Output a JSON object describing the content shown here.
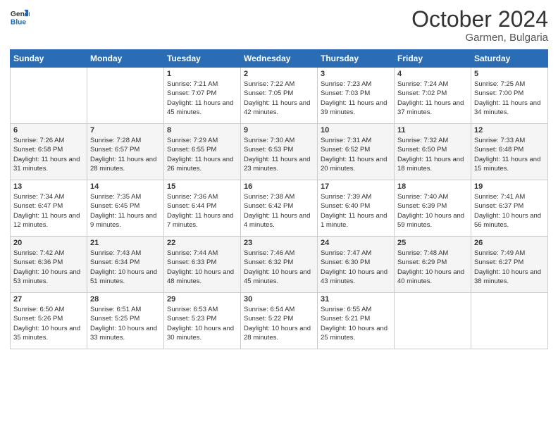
{
  "logo": {
    "line1": "General",
    "line2": "Blue"
  },
  "header": {
    "month": "October 2024",
    "location": "Garmen, Bulgaria"
  },
  "weekdays": [
    "Sunday",
    "Monday",
    "Tuesday",
    "Wednesday",
    "Thursday",
    "Friday",
    "Saturday"
  ],
  "rows": [
    [
      {
        "day": "",
        "sunrise": "",
        "sunset": "",
        "daylight": ""
      },
      {
        "day": "",
        "sunrise": "",
        "sunset": "",
        "daylight": ""
      },
      {
        "day": "1",
        "sunrise": "Sunrise: 7:21 AM",
        "sunset": "Sunset: 7:07 PM",
        "daylight": "Daylight: 11 hours and 45 minutes."
      },
      {
        "day": "2",
        "sunrise": "Sunrise: 7:22 AM",
        "sunset": "Sunset: 7:05 PM",
        "daylight": "Daylight: 11 hours and 42 minutes."
      },
      {
        "day": "3",
        "sunrise": "Sunrise: 7:23 AM",
        "sunset": "Sunset: 7:03 PM",
        "daylight": "Daylight: 11 hours and 39 minutes."
      },
      {
        "day": "4",
        "sunrise": "Sunrise: 7:24 AM",
        "sunset": "Sunset: 7:02 PM",
        "daylight": "Daylight: 11 hours and 37 minutes."
      },
      {
        "day": "5",
        "sunrise": "Sunrise: 7:25 AM",
        "sunset": "Sunset: 7:00 PM",
        "daylight": "Daylight: 11 hours and 34 minutes."
      }
    ],
    [
      {
        "day": "6",
        "sunrise": "Sunrise: 7:26 AM",
        "sunset": "Sunset: 6:58 PM",
        "daylight": "Daylight: 11 hours and 31 minutes."
      },
      {
        "day": "7",
        "sunrise": "Sunrise: 7:28 AM",
        "sunset": "Sunset: 6:57 PM",
        "daylight": "Daylight: 11 hours and 28 minutes."
      },
      {
        "day": "8",
        "sunrise": "Sunrise: 7:29 AM",
        "sunset": "Sunset: 6:55 PM",
        "daylight": "Daylight: 11 hours and 26 minutes."
      },
      {
        "day": "9",
        "sunrise": "Sunrise: 7:30 AM",
        "sunset": "Sunset: 6:53 PM",
        "daylight": "Daylight: 11 hours and 23 minutes."
      },
      {
        "day": "10",
        "sunrise": "Sunrise: 7:31 AM",
        "sunset": "Sunset: 6:52 PM",
        "daylight": "Daylight: 11 hours and 20 minutes."
      },
      {
        "day": "11",
        "sunrise": "Sunrise: 7:32 AM",
        "sunset": "Sunset: 6:50 PM",
        "daylight": "Daylight: 11 hours and 18 minutes."
      },
      {
        "day": "12",
        "sunrise": "Sunrise: 7:33 AM",
        "sunset": "Sunset: 6:48 PM",
        "daylight": "Daylight: 11 hours and 15 minutes."
      }
    ],
    [
      {
        "day": "13",
        "sunrise": "Sunrise: 7:34 AM",
        "sunset": "Sunset: 6:47 PM",
        "daylight": "Daylight: 11 hours and 12 minutes."
      },
      {
        "day": "14",
        "sunrise": "Sunrise: 7:35 AM",
        "sunset": "Sunset: 6:45 PM",
        "daylight": "Daylight: 11 hours and 9 minutes."
      },
      {
        "day": "15",
        "sunrise": "Sunrise: 7:36 AM",
        "sunset": "Sunset: 6:44 PM",
        "daylight": "Daylight: 11 hours and 7 minutes."
      },
      {
        "day": "16",
        "sunrise": "Sunrise: 7:38 AM",
        "sunset": "Sunset: 6:42 PM",
        "daylight": "Daylight: 11 hours and 4 minutes."
      },
      {
        "day": "17",
        "sunrise": "Sunrise: 7:39 AM",
        "sunset": "Sunset: 6:40 PM",
        "daylight": "Daylight: 11 hours and 1 minute."
      },
      {
        "day": "18",
        "sunrise": "Sunrise: 7:40 AM",
        "sunset": "Sunset: 6:39 PM",
        "daylight": "Daylight: 10 hours and 59 minutes."
      },
      {
        "day": "19",
        "sunrise": "Sunrise: 7:41 AM",
        "sunset": "Sunset: 6:37 PM",
        "daylight": "Daylight: 10 hours and 56 minutes."
      }
    ],
    [
      {
        "day": "20",
        "sunrise": "Sunrise: 7:42 AM",
        "sunset": "Sunset: 6:36 PM",
        "daylight": "Daylight: 10 hours and 53 minutes."
      },
      {
        "day": "21",
        "sunrise": "Sunrise: 7:43 AM",
        "sunset": "Sunset: 6:34 PM",
        "daylight": "Daylight: 10 hours and 51 minutes."
      },
      {
        "day": "22",
        "sunrise": "Sunrise: 7:44 AM",
        "sunset": "Sunset: 6:33 PM",
        "daylight": "Daylight: 10 hours and 48 minutes."
      },
      {
        "day": "23",
        "sunrise": "Sunrise: 7:46 AM",
        "sunset": "Sunset: 6:32 PM",
        "daylight": "Daylight: 10 hours and 45 minutes."
      },
      {
        "day": "24",
        "sunrise": "Sunrise: 7:47 AM",
        "sunset": "Sunset: 6:30 PM",
        "daylight": "Daylight: 10 hours and 43 minutes."
      },
      {
        "day": "25",
        "sunrise": "Sunrise: 7:48 AM",
        "sunset": "Sunset: 6:29 PM",
        "daylight": "Daylight: 10 hours and 40 minutes."
      },
      {
        "day": "26",
        "sunrise": "Sunrise: 7:49 AM",
        "sunset": "Sunset: 6:27 PM",
        "daylight": "Daylight: 10 hours and 38 minutes."
      }
    ],
    [
      {
        "day": "27",
        "sunrise": "Sunrise: 6:50 AM",
        "sunset": "Sunset: 5:26 PM",
        "daylight": "Daylight: 10 hours and 35 minutes."
      },
      {
        "day": "28",
        "sunrise": "Sunrise: 6:51 AM",
        "sunset": "Sunset: 5:25 PM",
        "daylight": "Daylight: 10 hours and 33 minutes."
      },
      {
        "day": "29",
        "sunrise": "Sunrise: 6:53 AM",
        "sunset": "Sunset: 5:23 PM",
        "daylight": "Daylight: 10 hours and 30 minutes."
      },
      {
        "day": "30",
        "sunrise": "Sunrise: 6:54 AM",
        "sunset": "Sunset: 5:22 PM",
        "daylight": "Daylight: 10 hours and 28 minutes."
      },
      {
        "day": "31",
        "sunrise": "Sunrise: 6:55 AM",
        "sunset": "Sunset: 5:21 PM",
        "daylight": "Daylight: 10 hours and 25 minutes."
      },
      {
        "day": "",
        "sunrise": "",
        "sunset": "",
        "daylight": ""
      },
      {
        "day": "",
        "sunrise": "",
        "sunset": "",
        "daylight": ""
      }
    ]
  ]
}
